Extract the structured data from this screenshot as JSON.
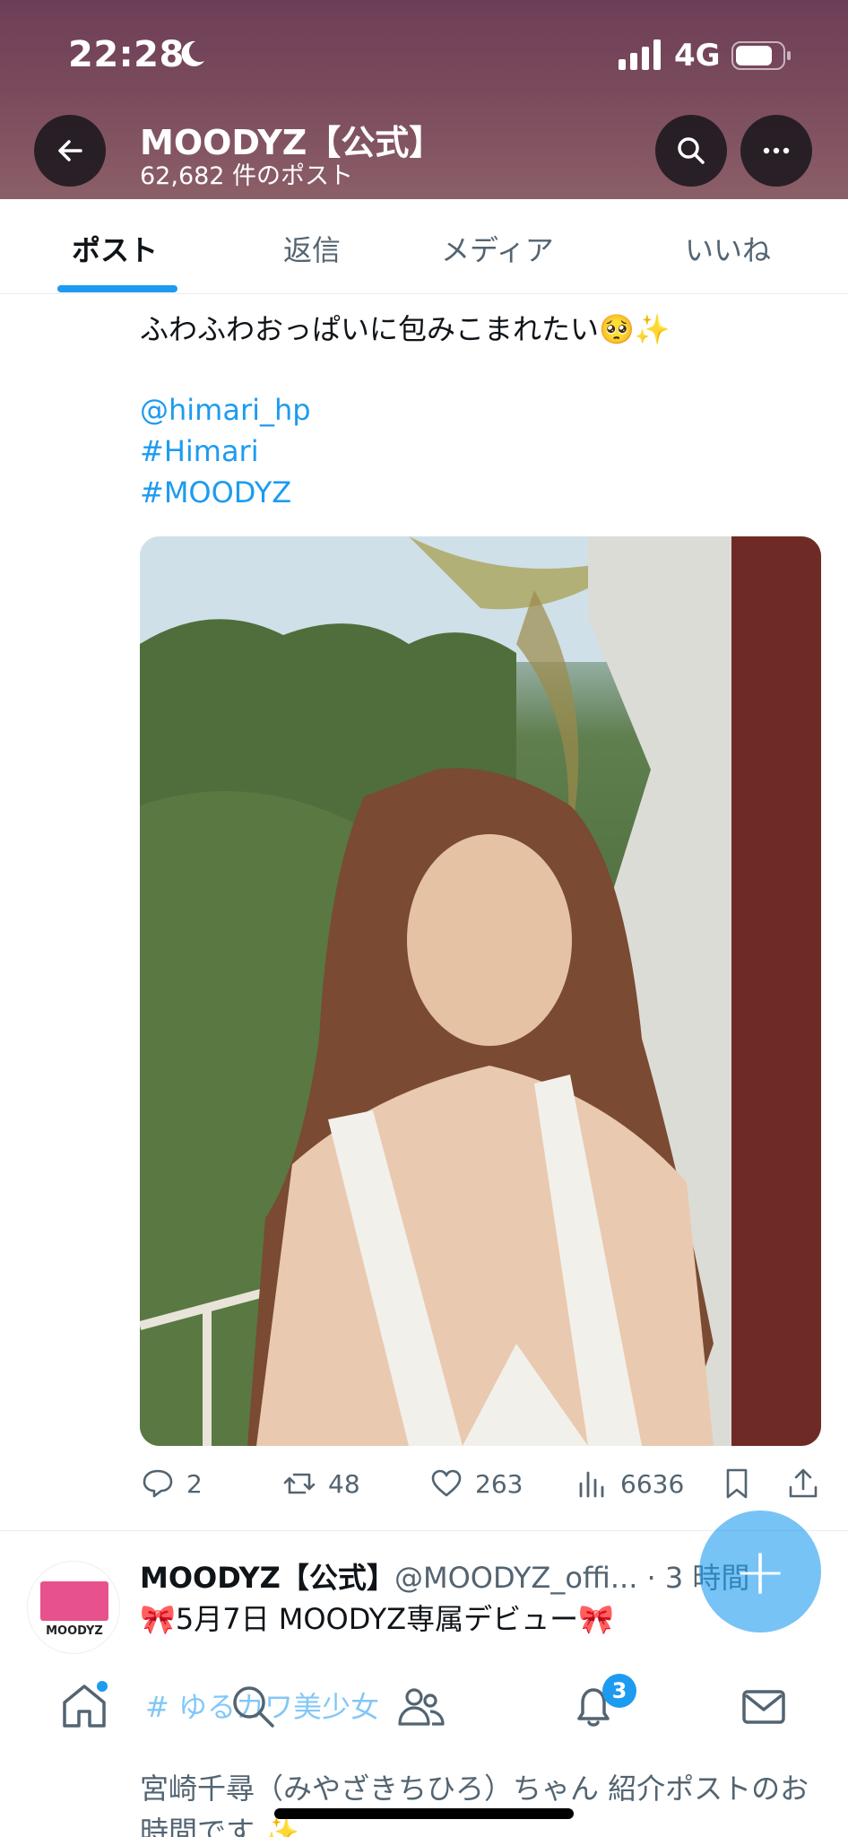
{
  "status_bar": {
    "time": "22:28",
    "network": "4G"
  },
  "header": {
    "name": "MOODYZ【公式】",
    "post_count": "62,682 件のポスト"
  },
  "tabs": [
    {
      "label": "ポスト",
      "active": true
    },
    {
      "label": "返信",
      "active": false
    },
    {
      "label": "メディア",
      "active": false
    },
    {
      "label": "いいね",
      "active": false
    }
  ],
  "tweet": {
    "text": "ふわふわおっぱいに包みこまれたい🥺✨",
    "mention": "@himari_hp",
    "hashtags": [
      "#Himari",
      "#MOODYZ"
    ],
    "stats": {
      "replies": "2",
      "reposts": "48",
      "likes": "263",
      "views": "6636"
    }
  },
  "next_tweet": {
    "avatar_text": "MOODYZ",
    "name": "MOODYZ【公式】",
    "handle_time": "@MOODYZ_offi... · 3 時間",
    "text": "🎀5月7日 MOODYZ専属デビュー🎀",
    "hashtag": "# ゆるカワ美少女",
    "body": "宮崎千尋（みやざきちひろ）ちゃん 紹介ポストのお時間です ✨"
  },
  "bottom_nav": {
    "notifications_badge": "3"
  },
  "icons": [
    "back-arrow-icon",
    "search-icon",
    "more-icon",
    "reply-icon",
    "repost-icon",
    "like-icon",
    "views-icon",
    "bookmark-icon",
    "share-icon",
    "home-icon",
    "explore-icon",
    "communities-icon",
    "notifications-icon",
    "messages-icon"
  ],
  "colors": {
    "accent": "#1d9bf0",
    "header_bg": "#7a4a5c",
    "text_secondary": "#536471"
  }
}
